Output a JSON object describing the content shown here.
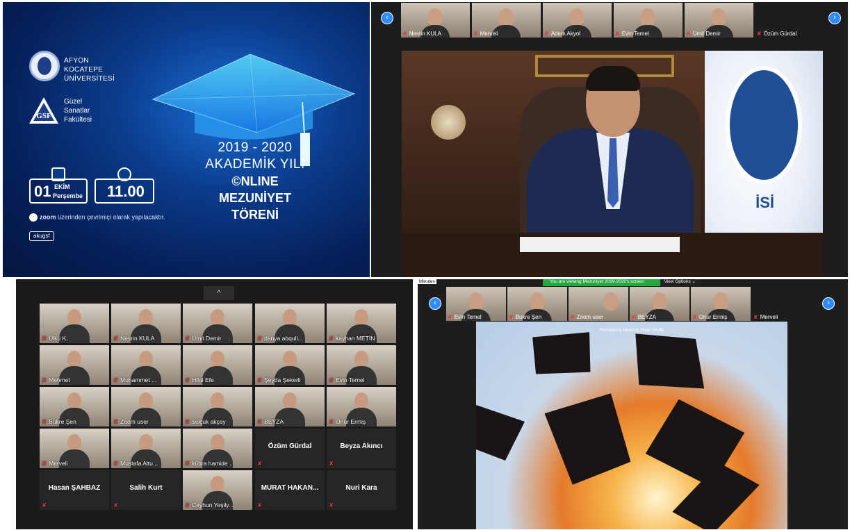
{
  "poster": {
    "university": [
      "AFYON",
      "KOCATEPE",
      "ÜNİVERSİTESİ"
    ],
    "faculty": [
      "Güzel",
      "Sanatlar",
      "Fakültesi"
    ],
    "year": "2019 - 2020",
    "academic": "AKADEMİK YILI",
    "online": "©NLINE",
    "ceremony1": "MEZUNİYET",
    "ceremony2": "TÖRENİ",
    "day": "01",
    "month": "EKİM",
    "weekday": "Perşembe",
    "time": "11.00",
    "zoom_word": "zoom",
    "zoom_text": "üzerinden çevrimiçi olarak yapılacaktır.",
    "social": "akugsf"
  },
  "top_strip": [
    "Nesrin KULA",
    "Merveli",
    "Adem Akyol",
    "Evin Temel",
    "Ümit Demir",
    "Özüm Gürdal"
  ],
  "speaker": {
    "flag_text": "İSİ"
  },
  "gallery": {
    "up_icon": "^",
    "tiles": [
      {
        "name": "Ülkü K.",
        "video": true
      },
      {
        "name": "Nesrin KULA",
        "video": true
      },
      {
        "name": "Ümit Demir",
        "video": true
      },
      {
        "name": "danya abqull...",
        "video": true
      },
      {
        "name": "kayhan METİN",
        "video": true
      },
      {
        "name": "Mehmet",
        "video": true
      },
      {
        "name": "Muhammet ...",
        "video": true
      },
      {
        "name": "Hilal Efe",
        "video": true
      },
      {
        "name": "Şeyda Şekerli",
        "video": true
      },
      {
        "name": "Evin Temel",
        "video": true
      },
      {
        "name": "Bukre Şen",
        "video": true
      },
      {
        "name": "Zoom user",
        "video": true
      },
      {
        "name": "selçuk akçay",
        "video": true
      },
      {
        "name": "BEYZA",
        "video": true
      },
      {
        "name": "Onur Ermiş",
        "video": true
      },
      {
        "name": "Merveli",
        "video": true
      },
      {
        "name": "Mustafa Altu...",
        "video": true
      },
      {
        "name": "kübra hamide ...",
        "video": true
      },
      {
        "name": "Özüm Gürdal",
        "video": false
      },
      {
        "name": "Beyza Akıncı",
        "video": false
      },
      {
        "name": "Hasan ŞAHBAZ",
        "video": false
      },
      {
        "name": "Salih Kurt",
        "video": false
      },
      {
        "name": "Ceyhun Yeşily...",
        "video": true
      },
      {
        "name": "MURAT HAKAN...",
        "video": false
      },
      {
        "name": "Nuri Kara",
        "video": false
      }
    ]
  },
  "share": {
    "minutes": "Minutes",
    "banner": "You are viewing Mezuniyet 2019-2020's screen",
    "view_options": "View Options ⌄",
    "remaining": "Remaining Meeting Time: 06:49",
    "strip": [
      "Evin Temel",
      "Bukre Şen",
      "Zoom user",
      "BEYZA",
      "Onur Ermiş",
      "Merveli"
    ]
  },
  "icons": {
    "prev": "‹",
    "next": "›",
    "mic_off": "🎤"
  }
}
